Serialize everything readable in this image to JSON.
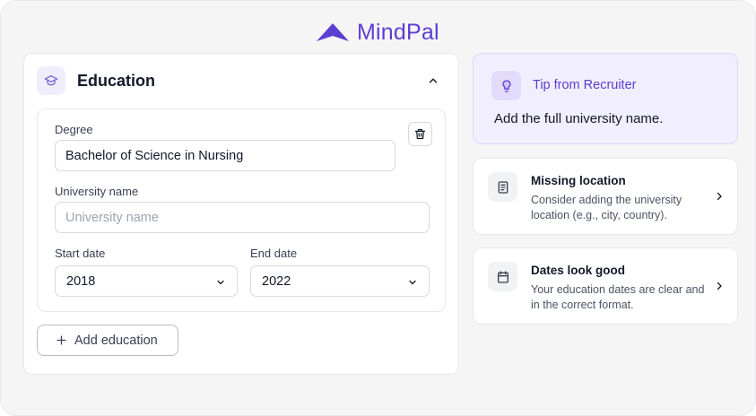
{
  "brand": {
    "name": "MindPal",
    "color": "#5b3fd0"
  },
  "education": {
    "title": "Education",
    "icon": "graduation-cap-icon",
    "entry": {
      "degree_label": "Degree",
      "degree_value": "Bachelor of Science in Nursing",
      "university_label": "University name",
      "university_value": "",
      "university_placeholder": "University name",
      "start_label": "Start date",
      "start_value": "2018",
      "end_label": "End date",
      "end_value": "2022"
    },
    "add_label": "Add education"
  },
  "tip": {
    "title": "Tip from Recruiter",
    "body": "Add the full university name.",
    "icon": "lightbulb-icon"
  },
  "checks": [
    {
      "title": "Missing location",
      "desc": "Consider adding the university location (e.g., city, country).",
      "icon": "document-icon"
    },
    {
      "title": "Dates look good",
      "desc": "Your education dates are clear and in the correct format.",
      "icon": "calendar-icon"
    }
  ]
}
